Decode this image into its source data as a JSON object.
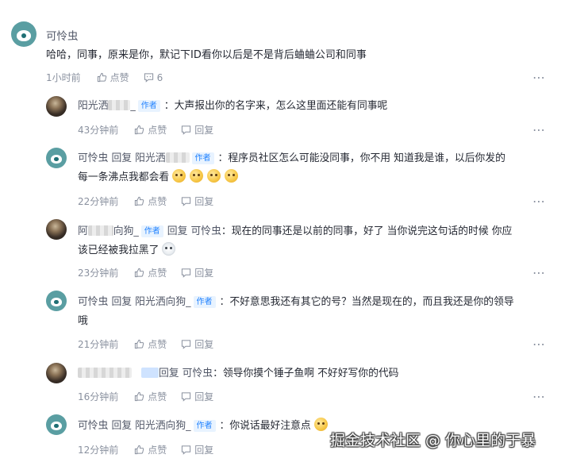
{
  "main_comment": {
    "author": "可怜虫",
    "text": "哈哈，同事，原来是你，默记下ID看你以后是不是背后蛐蛐公司和同事",
    "time": "1小时前",
    "like_label": "点赞",
    "reply_count": "6",
    "more": "⋯"
  },
  "author_tag": "作者",
  "reply_word": "回复",
  "like_label": "点赞",
  "reply_label": "回复",
  "replies": [
    {
      "author": "阳光洒",
      "author_tail": "_",
      "content": "：大声报出你的名字来，怎么这里面还能有同事呢",
      "time": "43分钟前"
    },
    {
      "author": "可怜虫",
      "target": "阳光洒",
      "content_1": "：程序员社区怎么可能没同事，你不用 知道我是谁，以后你发的",
      "content_2": "每一条沸点我都会看",
      "time": "22分钟前"
    },
    {
      "author_head": "阿",
      "author_mid": "向狗_",
      "target": "可怜虫",
      "content_1": "：现在的同事还是以前的同事，好了 当你说完这句话的时候 你应",
      "content_2": "该已经被我拉黑了",
      "time": "23分钟前"
    },
    {
      "author": "可怜虫",
      "target": "阳光洒向狗_",
      "content_1": "：不好意思我还有其它的号？当然是现在的，而且我还是你的领导",
      "content_2": "哦",
      "time": "21分钟前"
    },
    {
      "target": "可怜虫",
      "content": "：领导你摸个锤子鱼啊 不好好写你的代码",
      "time": "16分钟前"
    },
    {
      "author": "可怜虫",
      "target": "阳光洒向狗_",
      "content": "：你说话最好注意点",
      "time": "12分钟前"
    }
  ],
  "watermark": "掘金技术社区 @ 你心里的于暴",
  "colors": {
    "accent": "#1e80ff",
    "tag_bg": "#e8f3ff",
    "meta": "#8a919f",
    "text": "#252933"
  },
  "icons": [
    "thumb-up-icon",
    "comment-icon",
    "more-icon",
    "smile-emoji",
    "cat-emoji"
  ]
}
